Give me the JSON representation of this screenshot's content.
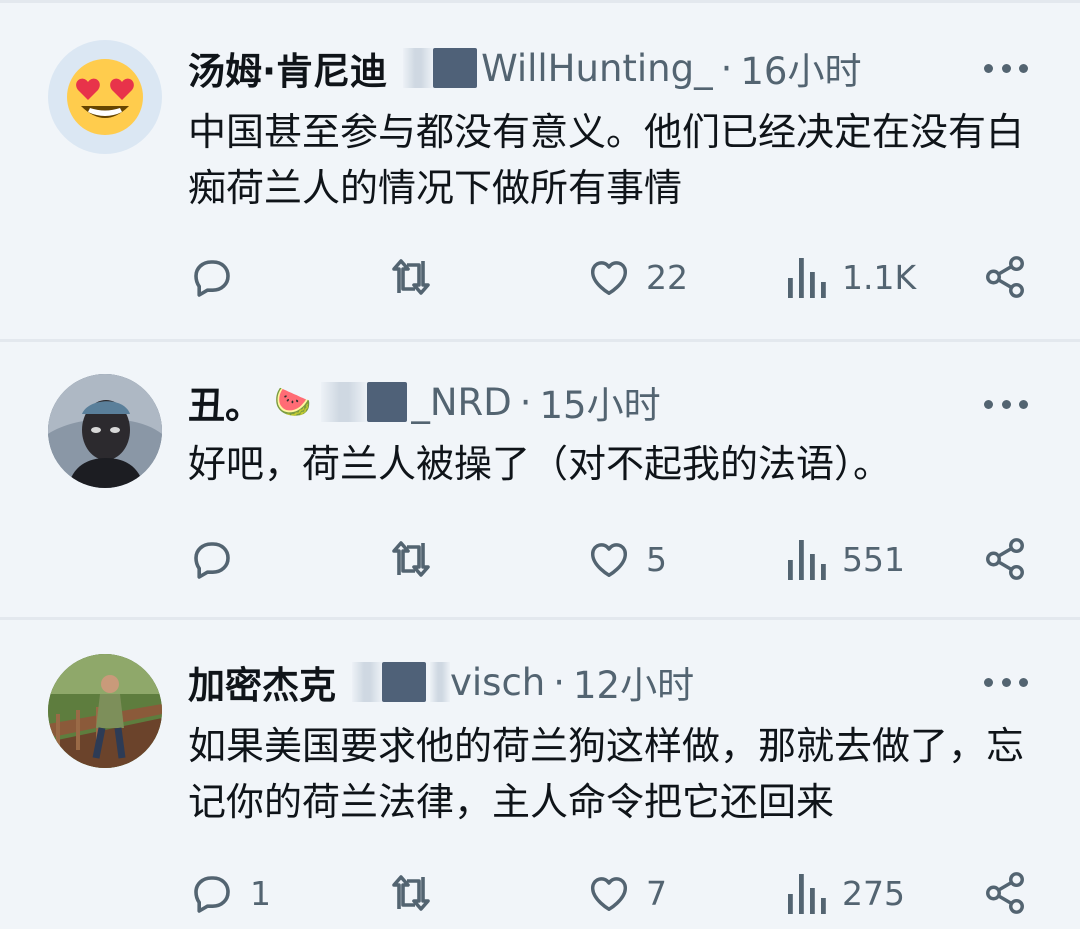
{
  "tweets": [
    {
      "name": "汤姆·肯尼迪",
      "handle_visible": "WillHunting_",
      "time": "16小时",
      "text": "中国甚至参与都没有意义。他们已经决定在没有白痴荷兰人的情况下做所有事情",
      "avatar": "heart-eyes-emoji",
      "counts": {
        "reply": "",
        "retweet": "",
        "like": "22",
        "views": "1.1K"
      }
    },
    {
      "name": "丑。",
      "name_emoji": "🍉",
      "handle_visible": "_NRD",
      "time": "15小时",
      "text": "好吧，荷兰人被操了（对不起我的法语）。",
      "avatar": "photo-portrait",
      "counts": {
        "reply": "",
        "retweet": "",
        "like": "5",
        "views": "551"
      }
    },
    {
      "name": "加密杰克",
      "handle_visible": "visch",
      "time": "12小时",
      "text": "如果美国要求他的荷兰狗这样做，那就去做了，忘记你的荷兰法律，主人命令把它还回来",
      "avatar": "photo-bridge",
      "counts": {
        "reply": "1",
        "retweet": "",
        "like": "7",
        "views": "275"
      }
    }
  ],
  "separator": "·",
  "icons": [
    "reply-icon",
    "retweet-icon",
    "like-icon",
    "views-icon",
    "share-icon",
    "more-icon"
  ],
  "colors": {
    "background": "#f1f5f9",
    "text": "#0f1419",
    "muted": "#536471"
  }
}
